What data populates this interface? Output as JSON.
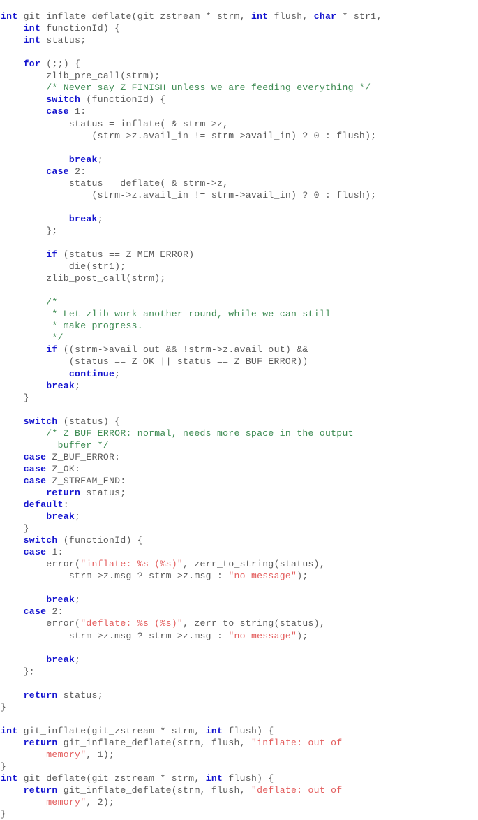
{
  "document": {
    "kind": "source-code-listing",
    "language": "C",
    "colors": {
      "background": "#ffffff",
      "plain_text": "#5a5a5a",
      "keyword": "#1414cf",
      "comment": "#3c8a51",
      "string": "#e35d5d"
    },
    "lines": [
      [
        [
          "kw",
          "int"
        ],
        [
          "pl",
          " git_inflate_deflate(git_zstream * strm, "
        ],
        [
          "kw",
          "int"
        ],
        [
          "pl",
          " flush, "
        ],
        [
          "kw",
          "char"
        ],
        [
          "pl",
          " * str1,"
        ]
      ],
      [
        [
          "pl",
          "    "
        ],
        [
          "kw",
          "int"
        ],
        [
          "pl",
          " functionId) {"
        ]
      ],
      [
        [
          "pl",
          "    "
        ],
        [
          "kw",
          "int"
        ],
        [
          "pl",
          " status;"
        ]
      ],
      [],
      [
        [
          "pl",
          "    "
        ],
        [
          "kw",
          "for"
        ],
        [
          "pl",
          " (;;) {"
        ]
      ],
      [
        [
          "pl",
          "        zlib_pre_call(strm);"
        ]
      ],
      [
        [
          "pl",
          "        "
        ],
        [
          "cm",
          "/* Never say Z_FINISH unless we are feeding everything */"
        ]
      ],
      [
        [
          "pl",
          "        "
        ],
        [
          "kw",
          "switch"
        ],
        [
          "pl",
          " (functionId) {"
        ]
      ],
      [
        [
          "pl",
          "        "
        ],
        [
          "kw",
          "case"
        ],
        [
          "pl",
          " 1:"
        ]
      ],
      [
        [
          "pl",
          "            status = inflate( & strm->z,"
        ]
      ],
      [
        [
          "pl",
          "                (strm->z.avail_in != strm->avail_in) ? 0 : flush);"
        ]
      ],
      [],
      [
        [
          "pl",
          "            "
        ],
        [
          "kw",
          "break"
        ],
        [
          "pl",
          ";"
        ]
      ],
      [
        [
          "pl",
          "        "
        ],
        [
          "kw",
          "case"
        ],
        [
          "pl",
          " 2:"
        ]
      ],
      [
        [
          "pl",
          "            status = deflate( & strm->z,"
        ]
      ],
      [
        [
          "pl",
          "                (strm->z.avail_in != strm->avail_in) ? 0 : flush);"
        ]
      ],
      [],
      [
        [
          "pl",
          "            "
        ],
        [
          "kw",
          "break"
        ],
        [
          "pl",
          ";"
        ]
      ],
      [
        [
          "pl",
          "        };"
        ]
      ],
      [],
      [
        [
          "pl",
          "        "
        ],
        [
          "kw",
          "if"
        ],
        [
          "pl",
          " (status == Z_MEM_ERROR)"
        ]
      ],
      [
        [
          "pl",
          "            die(str1);"
        ]
      ],
      [
        [
          "pl",
          "        zlib_post_call(strm);"
        ]
      ],
      [],
      [
        [
          "pl",
          "        "
        ],
        [
          "cm",
          "/*"
        ]
      ],
      [
        [
          "pl",
          "         "
        ],
        [
          "cm",
          "* Let zlib work another round, while we can still"
        ]
      ],
      [
        [
          "pl",
          "         "
        ],
        [
          "cm",
          "* make progress."
        ]
      ],
      [
        [
          "pl",
          "         "
        ],
        [
          "cm",
          "*/"
        ]
      ],
      [
        [
          "pl",
          "        "
        ],
        [
          "kw",
          "if"
        ],
        [
          "pl",
          " ((strm->avail_out && !strm->z.avail_out) &&"
        ]
      ],
      [
        [
          "pl",
          "            (status == Z_OK || status == Z_BUF_ERROR))"
        ]
      ],
      [
        [
          "pl",
          "            "
        ],
        [
          "kw",
          "continue"
        ],
        [
          "pl",
          ";"
        ]
      ],
      [
        [
          "pl",
          "        "
        ],
        [
          "kw",
          "break"
        ],
        [
          "pl",
          ";"
        ]
      ],
      [
        [
          "pl",
          "    }"
        ]
      ],
      [],
      [
        [
          "pl",
          "    "
        ],
        [
          "kw",
          "switch"
        ],
        [
          "pl",
          " (status) {"
        ]
      ],
      [
        [
          "pl",
          "        "
        ],
        [
          "cm",
          "/* Z_BUF_ERROR: normal, needs more space in the output"
        ]
      ],
      [
        [
          "pl",
          "          "
        ],
        [
          "cm",
          "buffer */"
        ]
      ],
      [
        [
          "pl",
          "    "
        ],
        [
          "kw",
          "case"
        ],
        [
          "pl",
          " Z_BUF_ERROR:"
        ]
      ],
      [
        [
          "pl",
          "    "
        ],
        [
          "kw",
          "case"
        ],
        [
          "pl",
          " Z_OK:"
        ]
      ],
      [
        [
          "pl",
          "    "
        ],
        [
          "kw",
          "case"
        ],
        [
          "pl",
          " Z_STREAM_END:"
        ]
      ],
      [
        [
          "pl",
          "        "
        ],
        [
          "kw",
          "return"
        ],
        [
          "pl",
          " status;"
        ]
      ],
      [
        [
          "pl",
          "    "
        ],
        [
          "kw",
          "default"
        ],
        [
          "pl",
          ":"
        ]
      ],
      [
        [
          "pl",
          "        "
        ],
        [
          "kw",
          "break"
        ],
        [
          "pl",
          ";"
        ]
      ],
      [
        [
          "pl",
          "    }"
        ]
      ],
      [
        [
          "pl",
          "    "
        ],
        [
          "kw",
          "switch"
        ],
        [
          "pl",
          " (functionId) {"
        ]
      ],
      [
        [
          "pl",
          "    "
        ],
        [
          "kw",
          "case"
        ],
        [
          "pl",
          " 1:"
        ]
      ],
      [
        [
          "pl",
          "        error("
        ],
        [
          "str",
          "\"inflate: %s (%s)\""
        ],
        [
          "pl",
          ", zerr_to_string(status),"
        ]
      ],
      [
        [
          "pl",
          "            strm->z.msg ? strm->z.msg : "
        ],
        [
          "str",
          "\"no message\""
        ],
        [
          "pl",
          ");"
        ]
      ],
      [],
      [
        [
          "pl",
          "        "
        ],
        [
          "kw",
          "break"
        ],
        [
          "pl",
          ";"
        ]
      ],
      [
        [
          "pl",
          "    "
        ],
        [
          "kw",
          "case"
        ],
        [
          "pl",
          " 2:"
        ]
      ],
      [
        [
          "pl",
          "        error("
        ],
        [
          "str",
          "\"deflate: %s (%s)\""
        ],
        [
          "pl",
          ", zerr_to_string(status),"
        ]
      ],
      [
        [
          "pl",
          "            strm->z.msg ? strm->z.msg : "
        ],
        [
          "str",
          "\"no message\""
        ],
        [
          "pl",
          ");"
        ]
      ],
      [],
      [
        [
          "pl",
          "        "
        ],
        [
          "kw",
          "break"
        ],
        [
          "pl",
          ";"
        ]
      ],
      [
        [
          "pl",
          "    };"
        ]
      ],
      [],
      [
        [
          "pl",
          "    "
        ],
        [
          "kw",
          "return"
        ],
        [
          "pl",
          " status;"
        ]
      ],
      [
        [
          "pl",
          "}"
        ]
      ],
      [],
      [
        [
          "kw",
          "int"
        ],
        [
          "pl",
          " git_inflate(git_zstream * strm, "
        ],
        [
          "kw",
          "int"
        ],
        [
          "pl",
          " flush) {"
        ]
      ],
      [
        [
          "pl",
          "    "
        ],
        [
          "kw",
          "return"
        ],
        [
          "pl",
          " git_inflate_deflate(strm, flush, "
        ],
        [
          "str",
          "\"inflate: out of"
        ]
      ],
      [
        [
          "str",
          "        memory\""
        ],
        [
          "pl",
          ", 1);"
        ]
      ],
      [
        [
          "pl",
          "}"
        ]
      ],
      [
        [
          "kw",
          "int"
        ],
        [
          "pl",
          " git_deflate(git_zstream * strm, "
        ],
        [
          "kw",
          "int"
        ],
        [
          "pl",
          " flush) {"
        ]
      ],
      [
        [
          "pl",
          "    "
        ],
        [
          "kw",
          "return"
        ],
        [
          "pl",
          " git_inflate_deflate(strm, flush, "
        ],
        [
          "str",
          "\"deflate: out of"
        ]
      ],
      [
        [
          "str",
          "        memory\""
        ],
        [
          "pl",
          ", 2);"
        ]
      ],
      [
        [
          "pl",
          "}"
        ]
      ]
    ]
  }
}
